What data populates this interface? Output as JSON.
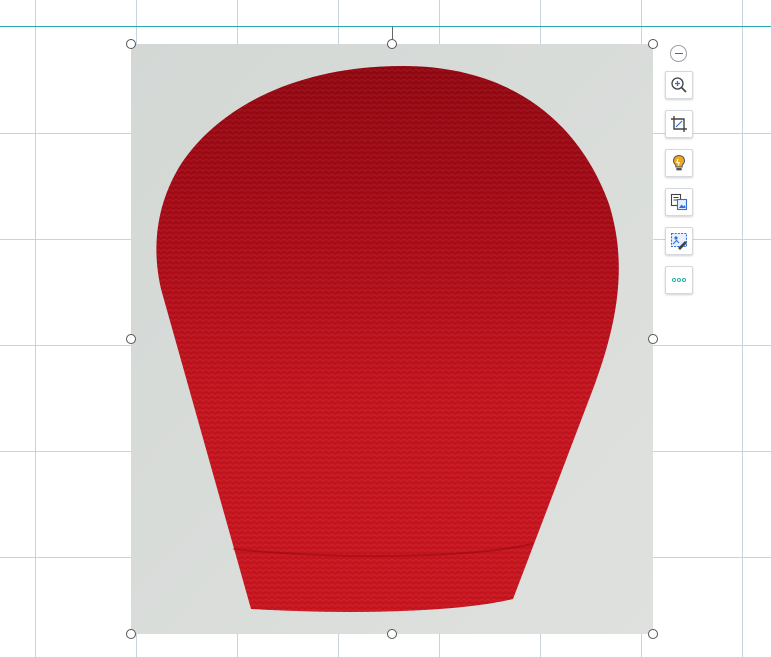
{
  "colors": {
    "grid_line": "#c9d3df",
    "guide_line": "#2aa7b0",
    "photo_background": "#d9dcd9",
    "object_red": "#c8141f",
    "icon_blue": "#2f6fdc",
    "icon_amber": "#f0a81c",
    "icon_teal": "#26b0a0"
  },
  "toolbar": {
    "items": [
      {
        "id": "collapse",
        "icon": "minus-circle-icon"
      },
      {
        "id": "zoom-in",
        "icon": "zoom-in-icon"
      },
      {
        "id": "crop",
        "icon": "crop-icon"
      },
      {
        "id": "ai-tips",
        "icon": "lightbulb-icon"
      },
      {
        "id": "image-convert",
        "icon": "image-convert-icon"
      },
      {
        "id": "image-edit",
        "icon": "image-edit-icon"
      },
      {
        "id": "more",
        "icon": "more-icon"
      }
    ]
  }
}
